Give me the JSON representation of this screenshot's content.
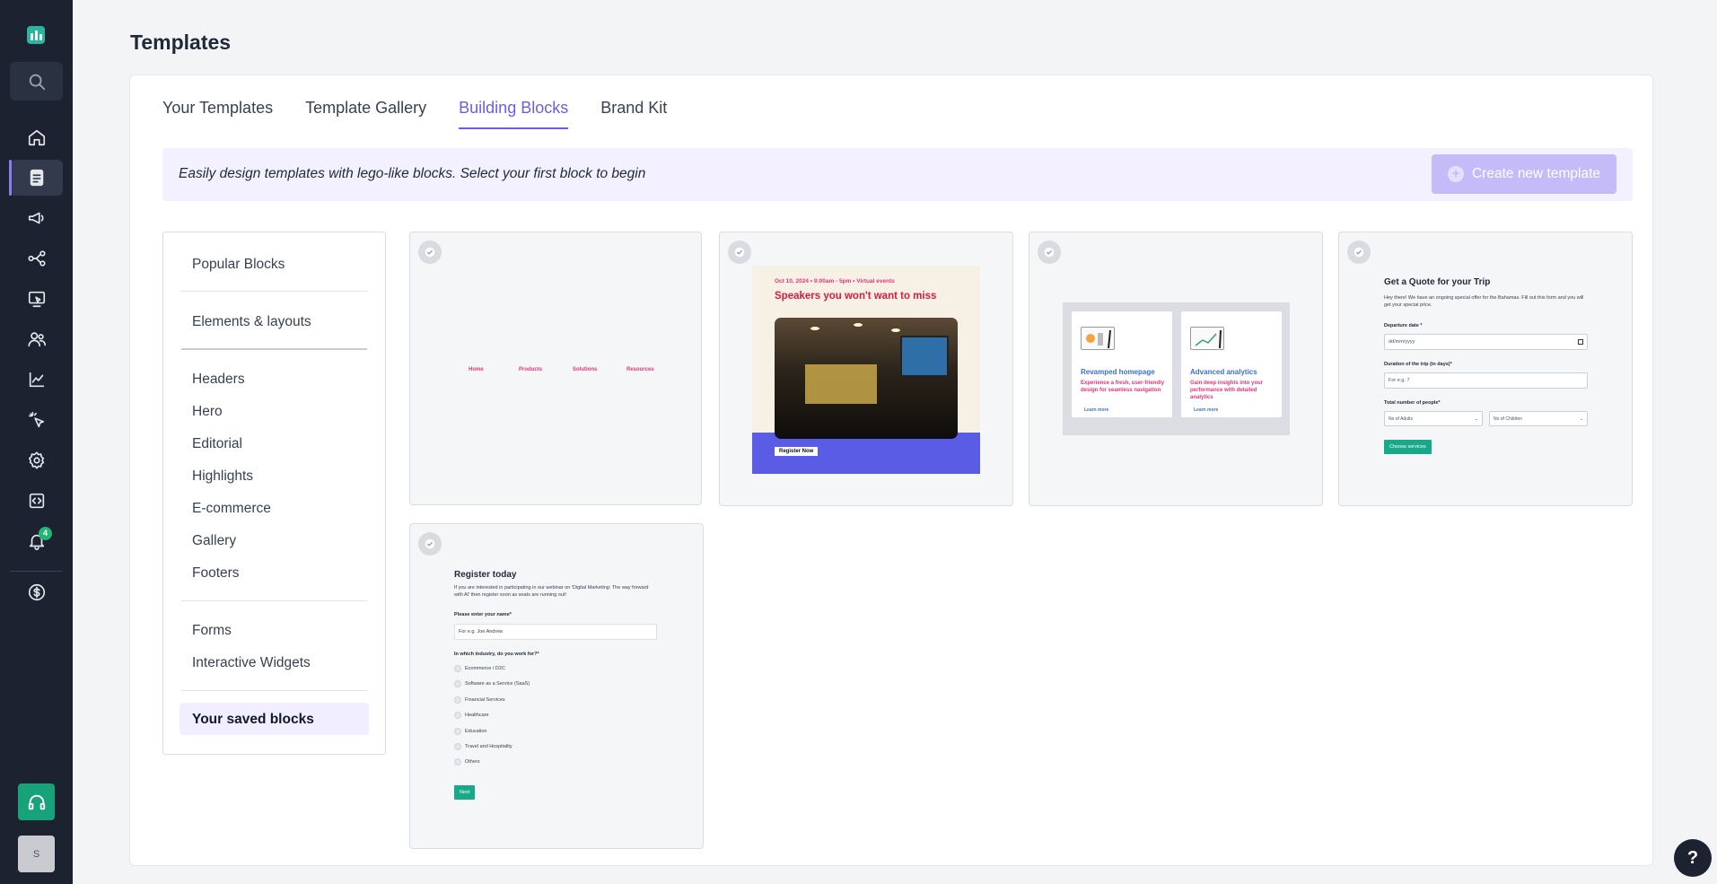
{
  "sidebar": {
    "notifications_count": "4",
    "avatar_initial": "S"
  },
  "header": {
    "title": "Templates"
  },
  "tabs": [
    {
      "label": "Your Templates",
      "active": false
    },
    {
      "label": "Template Gallery",
      "active": false
    },
    {
      "label": "Building Blocks",
      "active": true
    },
    {
      "label": "Brand Kit",
      "active": false
    }
  ],
  "banner": {
    "text": "Easily design templates with lego-like blocks. Select your first block to begin",
    "create_button": "Create new template"
  },
  "categories": {
    "popular": "Popular Blocks",
    "elements": "Elements & layouts",
    "headers": "Headers",
    "hero": "Hero",
    "editorial": "Editorial",
    "highlights": "Highlights",
    "ecommerce": "E-commerce",
    "gallery": "Gallery",
    "footers": "Footers",
    "forms": "Forms",
    "widgets": "Interactive Widgets",
    "saved": "Your saved blocks"
  },
  "blocks": {
    "nav": {
      "links": [
        "Home",
        "Products",
        "Solutions",
        "Resources"
      ]
    },
    "event": {
      "date": "Oct 10, 2024  •  9:00am - 5pm  •  Virtual events",
      "title": "Speakers you won't want to miss",
      "button": "Register Now"
    },
    "features": {
      "card1": {
        "title": "Revamped homepage",
        "desc": "Experience a fresh, user-friendly design for seamless navigation",
        "link": "Learn more"
      },
      "card2": {
        "title": "Advanced analytics",
        "desc": "Gain deep insights into your performance with detailed analytics",
        "link": "Learn more"
      }
    },
    "quote": {
      "title": "Get a Quote for your Trip",
      "subtitle": "Hey there! We have an ongoing special offer for the Bahamas. Fill out this form and you will get your special price.",
      "departure_label": "Departure date *",
      "departure_value": "dd/mm/yyyy",
      "duration_label": "Duration of the trip (in days)*",
      "duration_placeholder": "For e.g. 7",
      "people_label": "Total number of people*",
      "adults": "No of Adults",
      "children": "No of Children",
      "button": "Choose services"
    },
    "register": {
      "title": "Register today",
      "subtitle": "If you are interested in participating in our webinar on 'Digital Marketing: The way forward with AI' then register soon as seats are running out!",
      "name_label": "Please enter your name*",
      "name_placeholder": "For e.g. Joe Andrew",
      "industry_label": "In which industry, do you work for?*",
      "options": [
        "Ecommerce / D2C",
        "Software as a Service (SaaS)",
        "Financial Services",
        "Healthcare",
        "Education",
        "Travel and Hospitality",
        "Others"
      ],
      "button": "Next"
    }
  },
  "help": {
    "label": "?"
  },
  "colors": {
    "sidebar_bg": "#1c2230",
    "accent": "#6d5ce8",
    "brand_green": "#17a37a"
  }
}
